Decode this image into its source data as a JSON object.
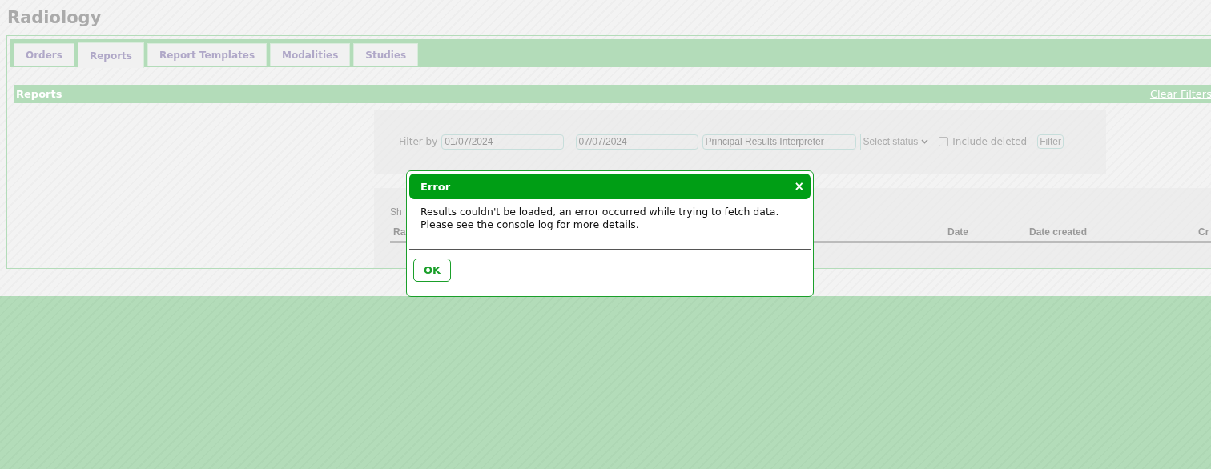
{
  "page": {
    "title": "Radiology"
  },
  "tabs": [
    {
      "label": "Orders",
      "selected": false
    },
    {
      "label": "Reports",
      "selected": true
    },
    {
      "label": "Report Templates",
      "selected": false
    },
    {
      "label": "Modalities",
      "selected": false
    },
    {
      "label": "Studies",
      "selected": false
    }
  ],
  "panel": {
    "title": "Reports",
    "clear_link": "Clear Filters"
  },
  "filter": {
    "label": "Filter by",
    "from_date": "01/07/2024",
    "separator": "-",
    "to_date": "07/07/2024",
    "interpreter_placeholder": "Principal Results Interpreter",
    "status_placeholder": "Select status",
    "include_deleted": {
      "label": "Include deleted",
      "checked": false
    },
    "button": "Filter"
  },
  "table": {
    "summary": "Sh",
    "columns": [
      "Ra",
      "Date",
      "Date created",
      "Cr"
    ]
  },
  "dialog": {
    "title": "Error",
    "close": "×",
    "message": [
      "Results couldn't be loaded, an error occurred while trying to fetch data.",
      "Please see the console log for more details."
    ],
    "button": "OK"
  }
}
